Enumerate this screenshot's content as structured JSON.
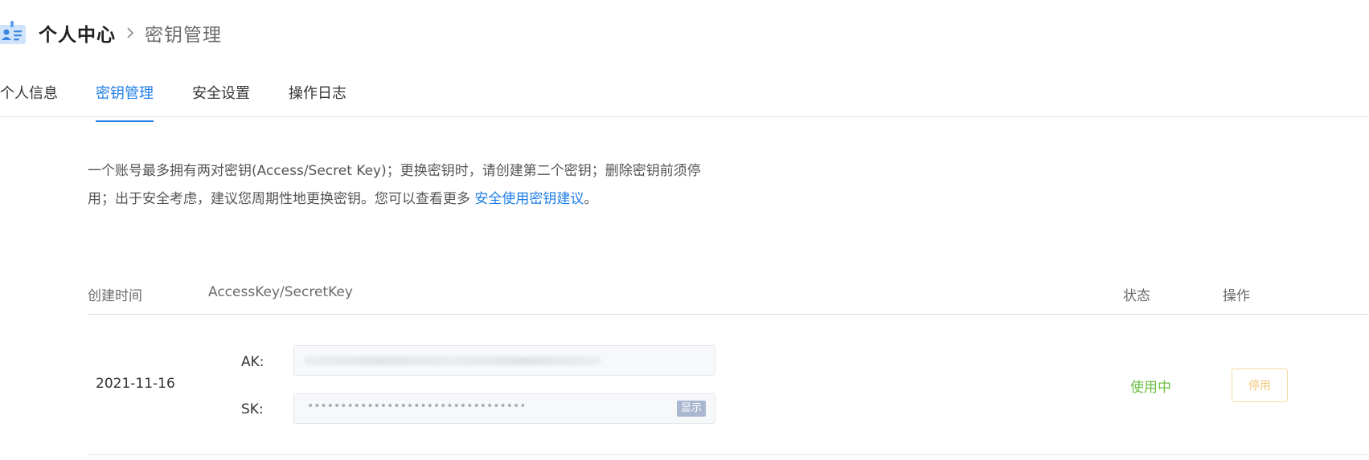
{
  "breadcrumb": {
    "icon": "id-card-icon",
    "current": "个人中心",
    "separator_icon": "chevron-right-icon",
    "child": "密钥管理"
  },
  "tabs": [
    {
      "label": "个人信息",
      "active": false
    },
    {
      "label": "密钥管理",
      "active": true
    },
    {
      "label": "安全设置",
      "active": false
    },
    {
      "label": "操作日志",
      "active": false
    }
  ],
  "description": {
    "line1": "一个账号最多拥有两对密钥(Access/Secret Key)；更换密钥时，请创建第二个密钥；删除密钥前须停",
    "line2_prefix": "用；出于安全考虑，建议您周期性地更换密钥。您可以查看更多 ",
    "link_text": "安全使用密钥建议",
    "line2_suffix": "。"
  },
  "table": {
    "headers": {
      "created": "创建时间",
      "keys": "AccessKey/SecretKey",
      "status": "状态",
      "actions": "操作"
    },
    "rows": [
      {
        "created": "2021-11-16",
        "ak_label": "AK:",
        "sk_label": "SK:",
        "sk_masked": "••••••••••••••••••••••••••••••••••••••••",
        "show_label": "显示",
        "status": "使用中",
        "disable_label": "停用"
      }
    ]
  },
  "colors": {
    "accent": "#1f7ee6",
    "status_active": "#6abf40",
    "warning_button": "#f0c67a"
  }
}
